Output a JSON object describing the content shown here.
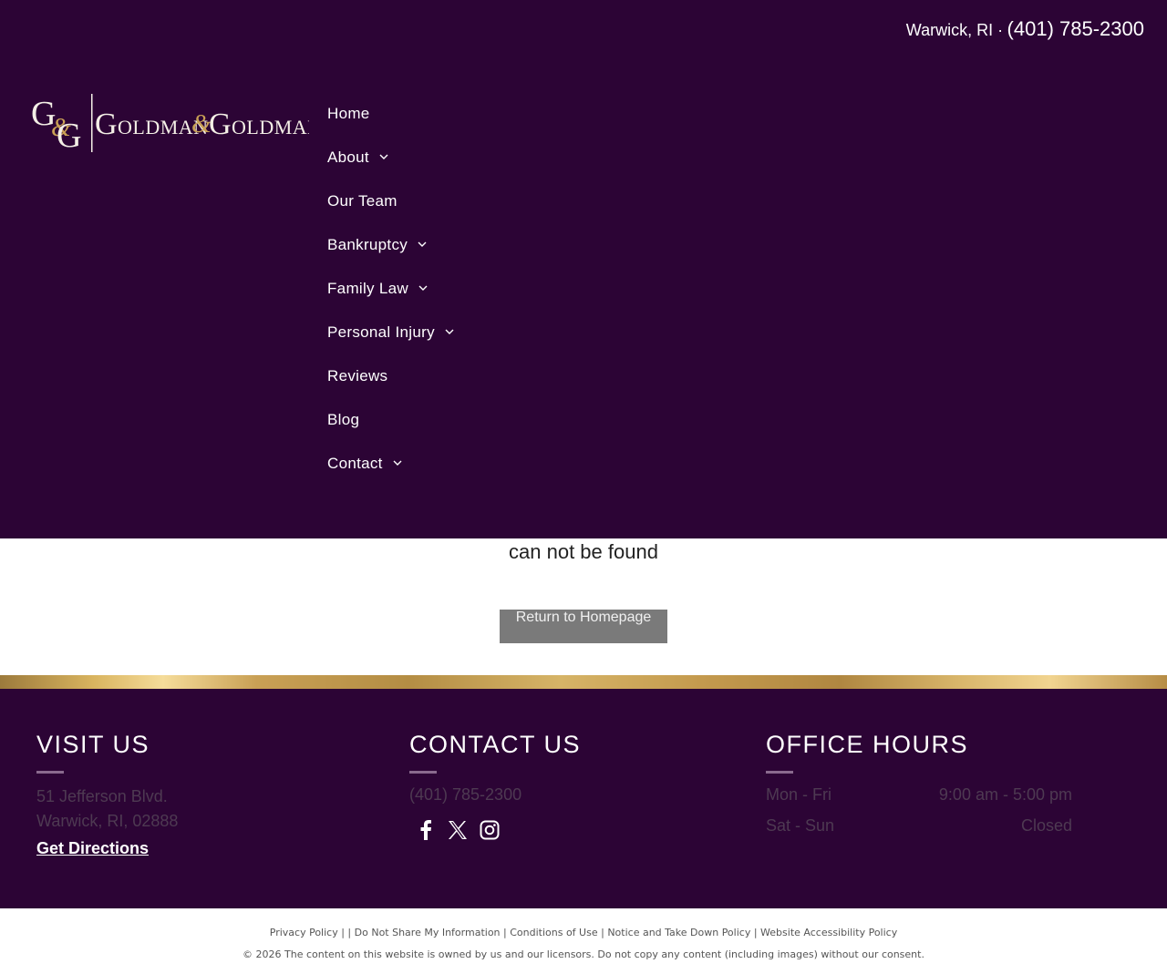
{
  "header": {
    "city": "Warwick, RI ·",
    "phone": "(401) 785-2300",
    "logo_text": "Goldman & Goldman",
    "nav": [
      {
        "label": "Home",
        "has_dropdown": false
      },
      {
        "label": "About",
        "has_dropdown": true
      },
      {
        "label": "Our Team",
        "has_dropdown": false
      },
      {
        "label": "Bankruptcy",
        "has_dropdown": true
      },
      {
        "label": "Family Law",
        "has_dropdown": true
      },
      {
        "label": "Personal Injury",
        "has_dropdown": true
      },
      {
        "label": "Reviews",
        "has_dropdown": false
      },
      {
        "label": "Blog",
        "has_dropdown": false
      },
      {
        "label": "Contact",
        "has_dropdown": true
      }
    ]
  },
  "main": {
    "message": "can not be found",
    "button_label": "Return to Homepage"
  },
  "footer": {
    "visit": {
      "title": "VISIT US",
      "address_line1": "51 Jefferson Blvd.",
      "address_line2": "Warwick, RI, 02888",
      "directions_label": "Get Directions"
    },
    "contact": {
      "title": "CONTACT US",
      "phone": "(401) 785-2300",
      "socials": [
        "facebook-icon",
        "x-twitter-icon",
        "instagram-icon"
      ]
    },
    "hours": {
      "title": "OFFICE HOURS",
      "rows": [
        {
          "days": "Mon - Fri",
          "time": "9:00 am - 5:00 pm"
        },
        {
          "days": "Sat - Sun",
          "time": "Closed"
        }
      ]
    }
  },
  "bottom": {
    "links": [
      "Privacy Policy",
      "Do Not Share My Information",
      "Conditions of Use",
      "Notice and Take Down Policy",
      "Website Accessibility Policy"
    ],
    "copyright": "© 2026 The content on this website is owned by us and our licensors. Do not copy any content (including images) without our consent."
  },
  "colors": {
    "header_bg": "#2c0435",
    "gold": "#c9a055",
    "muted_text": "#4e3a52",
    "button_bg": "#7a7a7a"
  }
}
